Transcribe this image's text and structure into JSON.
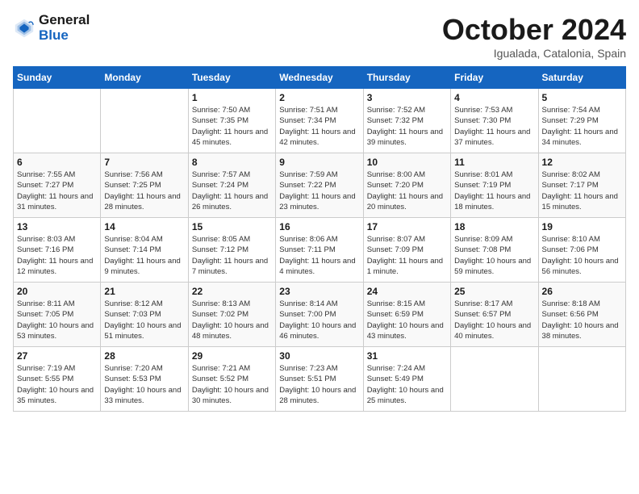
{
  "header": {
    "logo_line1": "General",
    "logo_line2": "Blue",
    "title": "October 2024",
    "subtitle": "Igualada, Catalonia, Spain"
  },
  "weekdays": [
    "Sunday",
    "Monday",
    "Tuesday",
    "Wednesday",
    "Thursday",
    "Friday",
    "Saturday"
  ],
  "weeks": [
    [
      {
        "day": "",
        "info": ""
      },
      {
        "day": "",
        "info": ""
      },
      {
        "day": "1",
        "info": "Sunrise: 7:50 AM\nSunset: 7:35 PM\nDaylight: 11 hours and 45 minutes."
      },
      {
        "day": "2",
        "info": "Sunrise: 7:51 AM\nSunset: 7:34 PM\nDaylight: 11 hours and 42 minutes."
      },
      {
        "day": "3",
        "info": "Sunrise: 7:52 AM\nSunset: 7:32 PM\nDaylight: 11 hours and 39 minutes."
      },
      {
        "day": "4",
        "info": "Sunrise: 7:53 AM\nSunset: 7:30 PM\nDaylight: 11 hours and 37 minutes."
      },
      {
        "day": "5",
        "info": "Sunrise: 7:54 AM\nSunset: 7:29 PM\nDaylight: 11 hours and 34 minutes."
      }
    ],
    [
      {
        "day": "6",
        "info": "Sunrise: 7:55 AM\nSunset: 7:27 PM\nDaylight: 11 hours and 31 minutes."
      },
      {
        "day": "7",
        "info": "Sunrise: 7:56 AM\nSunset: 7:25 PM\nDaylight: 11 hours and 28 minutes."
      },
      {
        "day": "8",
        "info": "Sunrise: 7:57 AM\nSunset: 7:24 PM\nDaylight: 11 hours and 26 minutes."
      },
      {
        "day": "9",
        "info": "Sunrise: 7:59 AM\nSunset: 7:22 PM\nDaylight: 11 hours and 23 minutes."
      },
      {
        "day": "10",
        "info": "Sunrise: 8:00 AM\nSunset: 7:20 PM\nDaylight: 11 hours and 20 minutes."
      },
      {
        "day": "11",
        "info": "Sunrise: 8:01 AM\nSunset: 7:19 PM\nDaylight: 11 hours and 18 minutes."
      },
      {
        "day": "12",
        "info": "Sunrise: 8:02 AM\nSunset: 7:17 PM\nDaylight: 11 hours and 15 minutes."
      }
    ],
    [
      {
        "day": "13",
        "info": "Sunrise: 8:03 AM\nSunset: 7:16 PM\nDaylight: 11 hours and 12 minutes."
      },
      {
        "day": "14",
        "info": "Sunrise: 8:04 AM\nSunset: 7:14 PM\nDaylight: 11 hours and 9 minutes."
      },
      {
        "day": "15",
        "info": "Sunrise: 8:05 AM\nSunset: 7:12 PM\nDaylight: 11 hours and 7 minutes."
      },
      {
        "day": "16",
        "info": "Sunrise: 8:06 AM\nSunset: 7:11 PM\nDaylight: 11 hours and 4 minutes."
      },
      {
        "day": "17",
        "info": "Sunrise: 8:07 AM\nSunset: 7:09 PM\nDaylight: 11 hours and 1 minute."
      },
      {
        "day": "18",
        "info": "Sunrise: 8:09 AM\nSunset: 7:08 PM\nDaylight: 10 hours and 59 minutes."
      },
      {
        "day": "19",
        "info": "Sunrise: 8:10 AM\nSunset: 7:06 PM\nDaylight: 10 hours and 56 minutes."
      }
    ],
    [
      {
        "day": "20",
        "info": "Sunrise: 8:11 AM\nSunset: 7:05 PM\nDaylight: 10 hours and 53 minutes."
      },
      {
        "day": "21",
        "info": "Sunrise: 8:12 AM\nSunset: 7:03 PM\nDaylight: 10 hours and 51 minutes."
      },
      {
        "day": "22",
        "info": "Sunrise: 8:13 AM\nSunset: 7:02 PM\nDaylight: 10 hours and 48 minutes."
      },
      {
        "day": "23",
        "info": "Sunrise: 8:14 AM\nSunset: 7:00 PM\nDaylight: 10 hours and 46 minutes."
      },
      {
        "day": "24",
        "info": "Sunrise: 8:15 AM\nSunset: 6:59 PM\nDaylight: 10 hours and 43 minutes."
      },
      {
        "day": "25",
        "info": "Sunrise: 8:17 AM\nSunset: 6:57 PM\nDaylight: 10 hours and 40 minutes."
      },
      {
        "day": "26",
        "info": "Sunrise: 8:18 AM\nSunset: 6:56 PM\nDaylight: 10 hours and 38 minutes."
      }
    ],
    [
      {
        "day": "27",
        "info": "Sunrise: 7:19 AM\nSunset: 5:55 PM\nDaylight: 10 hours and 35 minutes."
      },
      {
        "day": "28",
        "info": "Sunrise: 7:20 AM\nSunset: 5:53 PM\nDaylight: 10 hours and 33 minutes."
      },
      {
        "day": "29",
        "info": "Sunrise: 7:21 AM\nSunset: 5:52 PM\nDaylight: 10 hours and 30 minutes."
      },
      {
        "day": "30",
        "info": "Sunrise: 7:23 AM\nSunset: 5:51 PM\nDaylight: 10 hours and 28 minutes."
      },
      {
        "day": "31",
        "info": "Sunrise: 7:24 AM\nSunset: 5:49 PM\nDaylight: 10 hours and 25 minutes."
      },
      {
        "day": "",
        "info": ""
      },
      {
        "day": "",
        "info": ""
      }
    ]
  ]
}
